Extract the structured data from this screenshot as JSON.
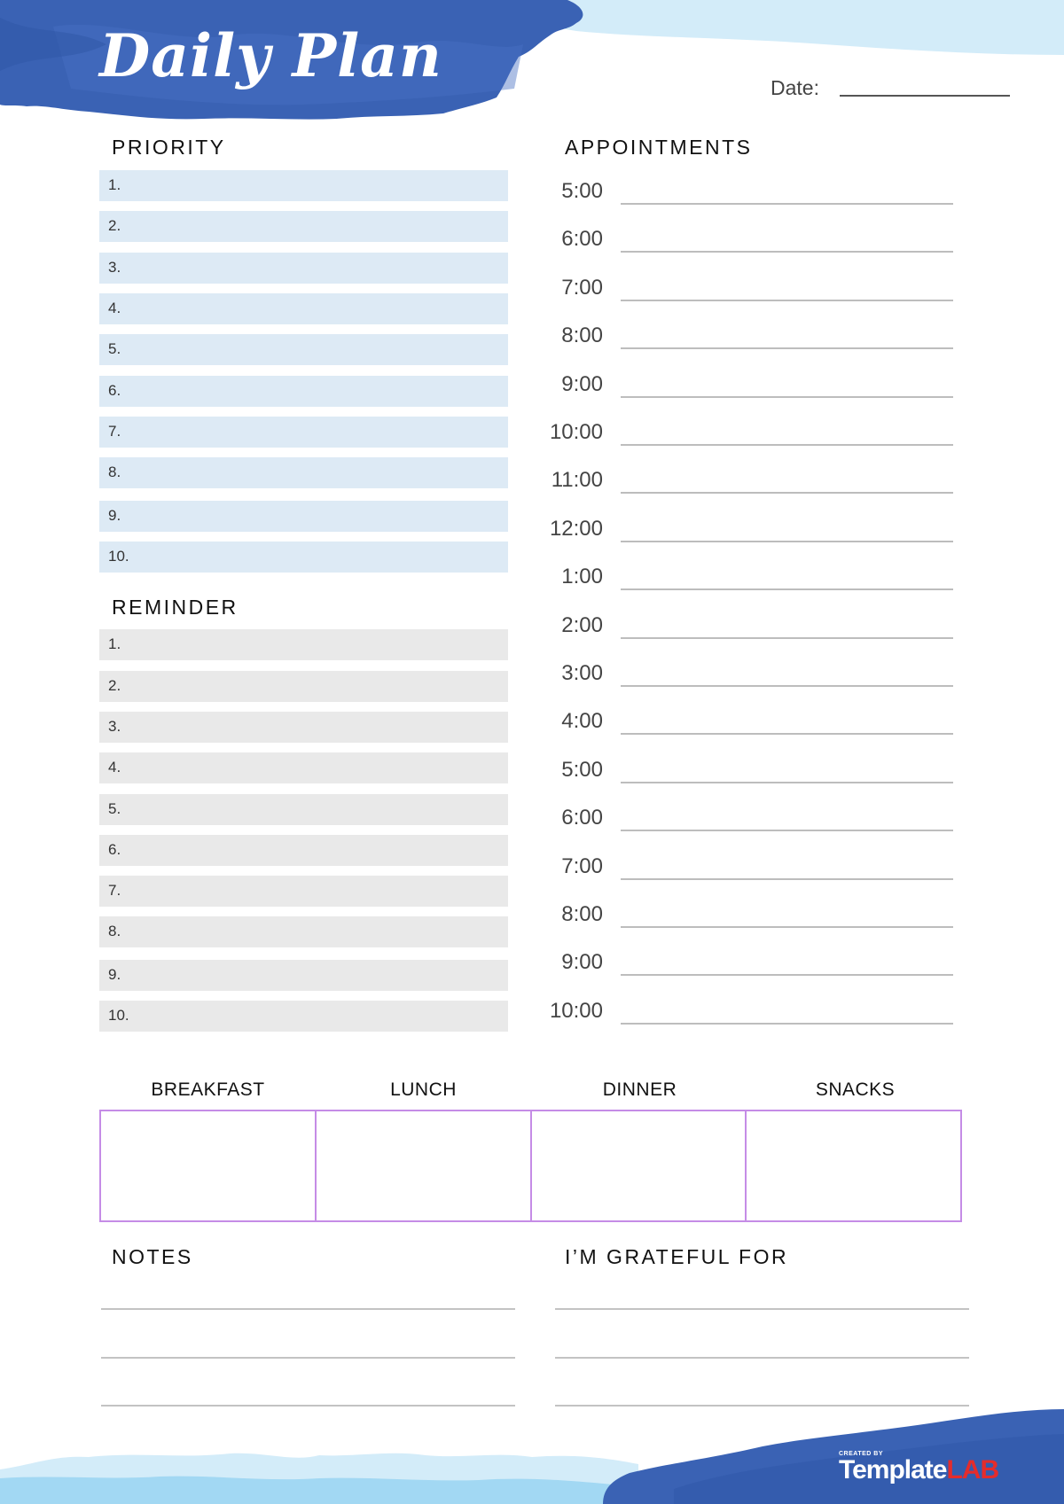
{
  "header": {
    "title": "Daily Plan",
    "date_label": "Date:"
  },
  "colors": {
    "header_blue": "#3a62b4",
    "light_blue": "#d3ecf9",
    "priority_row": "#ddeaf5",
    "reminder_row": "#e9e9e9",
    "meal_border": "#c58ce6",
    "logo_red": "#e42c2c"
  },
  "priority": {
    "title": "PRIORITY",
    "items": [
      "1.",
      "2.",
      "3.",
      "4.",
      "5.",
      "6.",
      "7.",
      "8.",
      "9.",
      "10."
    ]
  },
  "reminder": {
    "title": "REMINDER",
    "items": [
      "1.",
      "2.",
      "3.",
      "4.",
      "5.",
      "6.",
      "7.",
      "8.",
      "9.",
      "10."
    ]
  },
  "appointments": {
    "title": "APPOINTMENTS",
    "times": [
      "5:00",
      "6:00",
      "7:00",
      "8:00",
      "9:00",
      "10:00",
      "11:00",
      "12:00",
      "1:00",
      "2:00",
      "3:00",
      "4:00",
      "5:00",
      "6:00",
      "7:00",
      "8:00",
      "9:00",
      "10:00"
    ]
  },
  "meals": {
    "headers": [
      "BREAKFAST",
      "LUNCH",
      "DINNER",
      "SNACKS"
    ]
  },
  "notes": {
    "title": "NOTES"
  },
  "grateful": {
    "title": "I’M GRATEFUL FOR"
  },
  "footer": {
    "created_by": "CREATED BY",
    "logo_template": "Template",
    "logo_lab": "LAB"
  }
}
